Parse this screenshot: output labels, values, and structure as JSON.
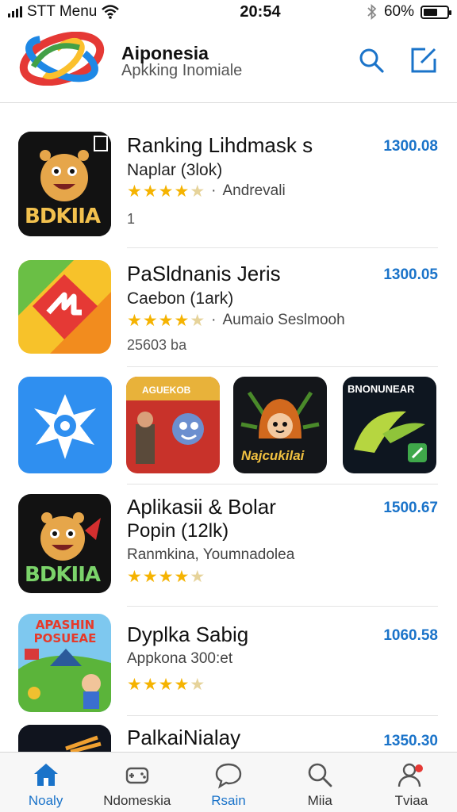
{
  "status_bar": {
    "carrier": "STT Menu",
    "time": "20:54",
    "battery_percent": "60%",
    "battery_level": 0.6
  },
  "header": {
    "title": "Aiponesia",
    "subtitle": "Apkking Inomiale"
  },
  "apps": [
    {
      "name": "Ranking Lihdmask s",
      "subtitle": "Naplar (3lok)",
      "rating": 4.5,
      "meta": "Andrevali",
      "extra": "1",
      "price": "1300.08",
      "icon_text": "BDKIIA"
    },
    {
      "name": "PaSldnanis Jeris",
      "subtitle": "Caebon (1ark)",
      "rating": 4.5,
      "meta": "Aumaio Seslmooh",
      "extra": "25603 ba",
      "price": "1300.05"
    },
    {
      "name": "Aplikasii & Bolar",
      "subtitle": "Popin (12lk)",
      "meta": "Ranmkina, Youmnadolea",
      "rating": 4.5,
      "price": "1500.67",
      "icon_text": "BDKIIA"
    },
    {
      "name": "Dyplka Sabig",
      "subtitle": "Appkona 300:et",
      "rating": 4.5,
      "price": "1060.58",
      "icon_text": "APASHIN POSUEAE"
    },
    {
      "name": "PalkaiNialay",
      "price": "1350.30"
    }
  ],
  "featured": [
    {
      "icon": "shuriken-icon"
    },
    {
      "icon": "cartoon-game-icon",
      "text": "AGUEKOB"
    },
    {
      "icon": "hooded-character-icon",
      "text": "Najcukilai"
    },
    {
      "icon": "leaf-icon",
      "text": "BNONUNEAR"
    }
  ],
  "tabs": [
    {
      "label": "Noaly",
      "icon": "home-icon",
      "active": true
    },
    {
      "label": "Ndomeskia",
      "icon": "games-icon",
      "active": false
    },
    {
      "label": "Rsain",
      "icon": "chat-icon",
      "active": false
    },
    {
      "label": "Miia",
      "icon": "search-icon",
      "active": false
    },
    {
      "label": "Tviaa",
      "icon": "profile-icon",
      "active": false
    }
  ],
  "colors": {
    "accent": "#1a73c9",
    "star": "#f5b301"
  }
}
